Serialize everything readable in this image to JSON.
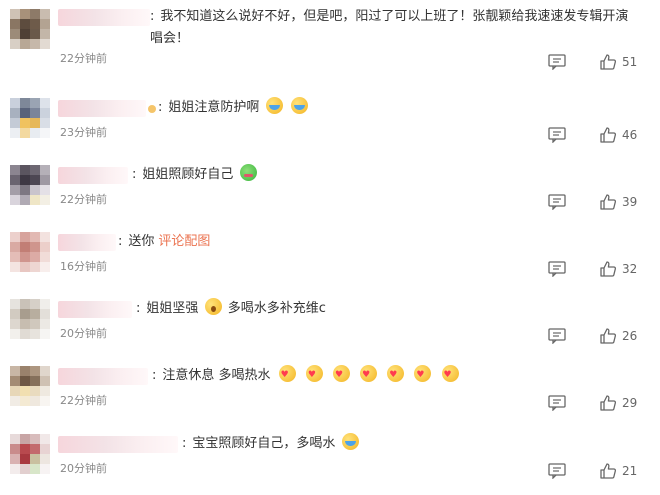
{
  "comments": [
    {
      "name": "",
      "text": "我不知道这么说好不好，但是吧，阳过了可以上班了！张靓颖给我速速发专辑开演唱会！",
      "time": "22分钟前",
      "likes": "51",
      "emoji": []
    },
    {
      "name": "",
      "text": "姐姐注意防护啊",
      "time": "23分钟前",
      "likes": "46",
      "emoji": [
        "crying-face",
        "crying-face"
      ]
    },
    {
      "name": "",
      "text": "姐姐照顾好自己",
      "time": "22分钟前",
      "likes": "39",
      "emoji": [
        "frog-face"
      ]
    },
    {
      "name": "",
      "text": "送你",
      "link": "评论配图",
      "time": "16分钟前",
      "likes": "32",
      "emoji": []
    },
    {
      "name": "",
      "text": "姐姐坚强",
      "text2": "多喝水多补充维c",
      "time": "20分钟前",
      "likes": "26",
      "emoji": [
        "shocked-face"
      ]
    },
    {
      "name": "",
      "text": "注意休息 多喝热水",
      "time": "22分钟前",
      "likes": "29",
      "emoji": [
        "heart-kiss-face",
        "heart-kiss-face",
        "heart-kiss-face",
        "heart-kiss-face",
        "heart-kiss-face",
        "heart-kiss-face",
        "heart-kiss-face"
      ]
    },
    {
      "name": "",
      "text": "宝宝照顾好自己，多喝水",
      "time": "20分钟前",
      "likes": "21",
      "emoji": [
        "crying-face"
      ]
    }
  ],
  "icons": {
    "reply": "comment-bubble-icon",
    "like": "thumbs-up-icon"
  },
  "colors": {
    "text": "#333333",
    "time": "#888888",
    "link": "#eb7350"
  }
}
